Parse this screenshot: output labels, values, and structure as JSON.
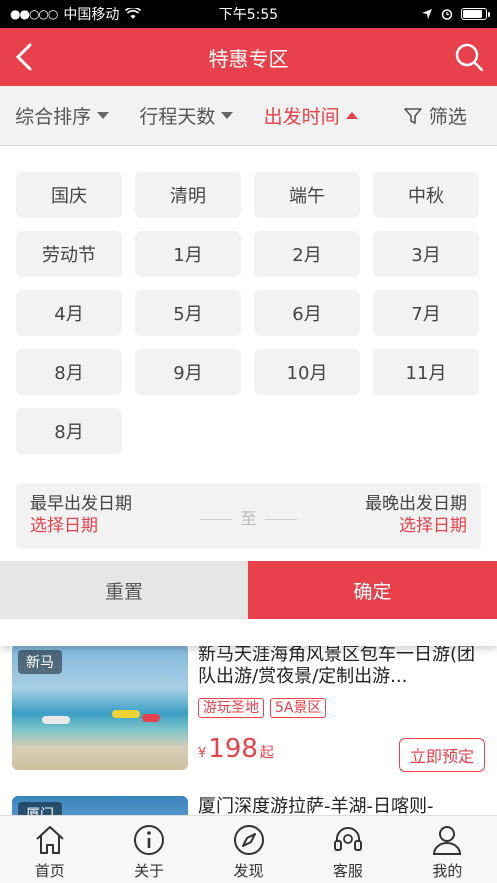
{
  "status_bar": {
    "carrier": "中国移动",
    "time": "下午5:55"
  },
  "nav": {
    "title": "特惠专区"
  },
  "filters": [
    {
      "label": "综合排序",
      "active": false
    },
    {
      "label": "行程天数",
      "active": false
    },
    {
      "label": "出发时间",
      "active": true
    },
    {
      "label": "筛选",
      "active": false
    }
  ],
  "date_options": [
    "国庆",
    "清明",
    "端午",
    "中秋",
    "劳动节",
    "1月",
    "2月",
    "3月",
    "4月",
    "5月",
    "6月",
    "7月",
    "8月",
    "9月",
    "10月",
    "11月",
    "8月"
  ],
  "date_range": {
    "earliest_label": "最早出发日期",
    "earliest_value": "选择日期",
    "separator": "至",
    "latest_label": "最晚出发日期",
    "latest_value": "选择日期"
  },
  "actions": {
    "reset": "重置",
    "confirm": "确定"
  },
  "products": [
    {
      "tag": "新马",
      "title": "新马天涯海角风景区包车一日游(团队出游/赏夜景/定制出游...",
      "chips": [
        "游玩圣地",
        "5A景区"
      ],
      "price_currency": "¥",
      "price": "198",
      "price_suffix": "起",
      "book_label": "立即预定"
    },
    {
      "tag": "厦门",
      "title": "厦门深度游拉萨-羊湖-日喀则-"
    }
  ],
  "tabbar": [
    {
      "label": "首页",
      "icon": "home-icon"
    },
    {
      "label": "关于",
      "icon": "info-icon"
    },
    {
      "label": "发现",
      "icon": "compass-icon"
    },
    {
      "label": "客服",
      "icon": "headset-icon"
    },
    {
      "label": "我的",
      "icon": "user-icon"
    }
  ],
  "colors": {
    "accent": "#e8414b",
    "panel_bg": "#f2f2f2"
  }
}
